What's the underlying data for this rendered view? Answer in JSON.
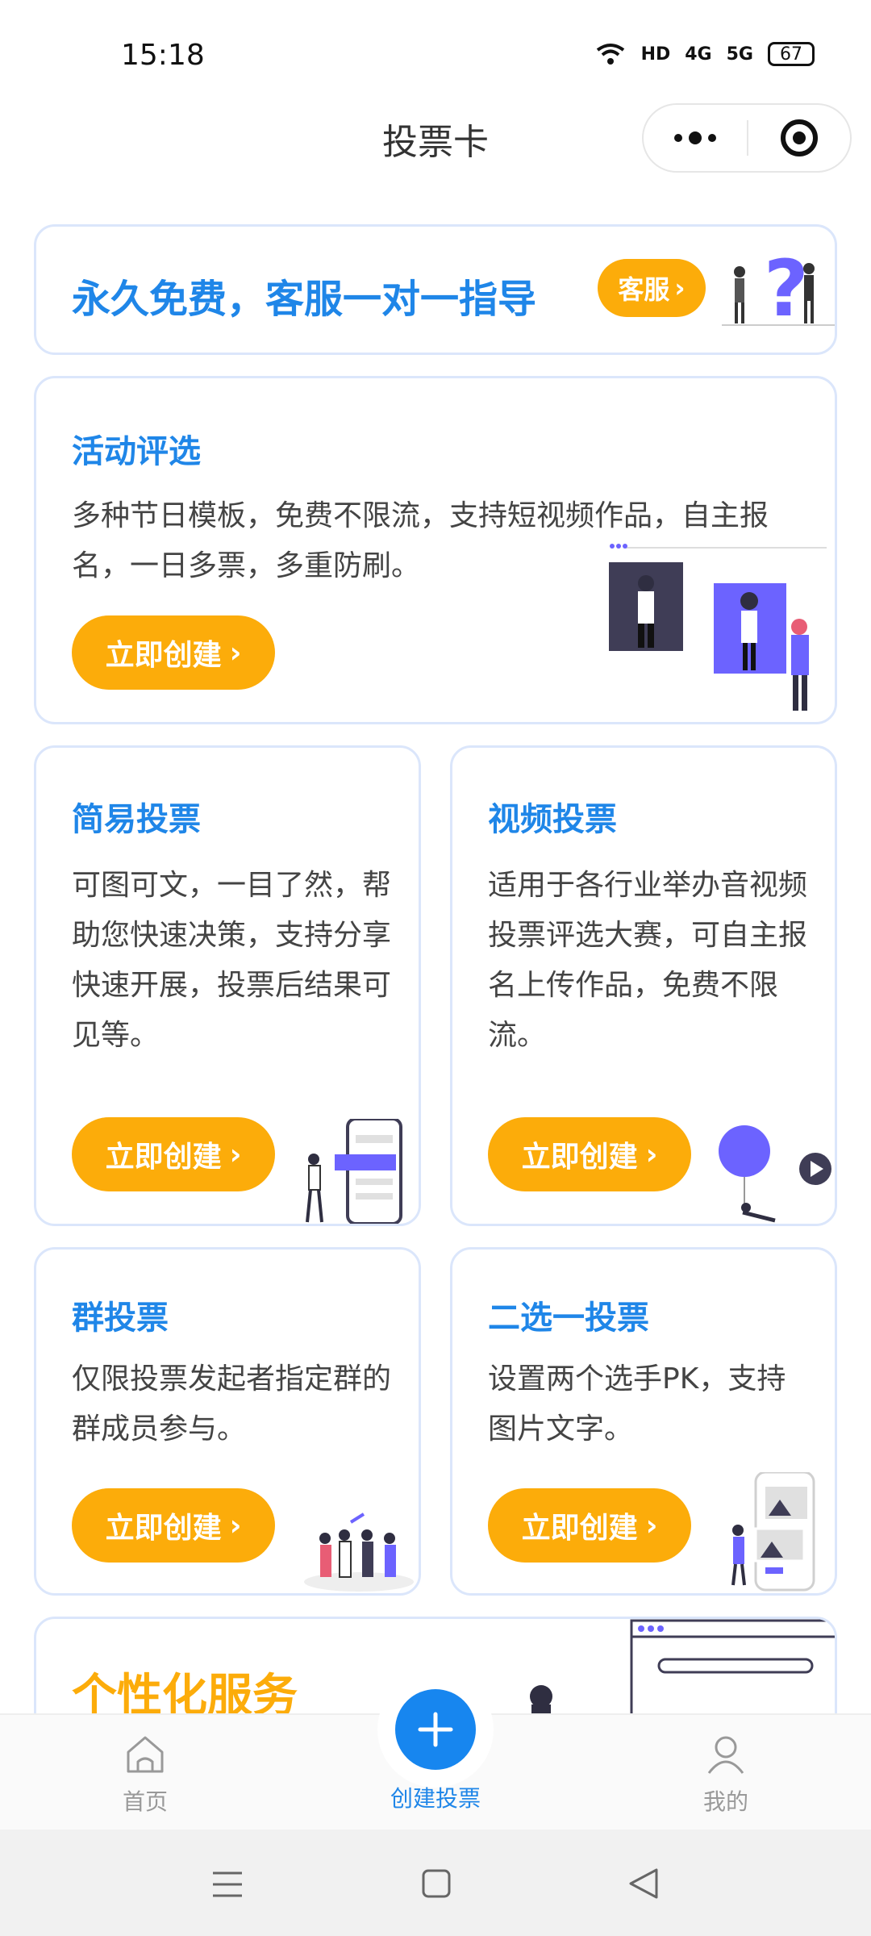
{
  "status_bar": {
    "time": "15:18",
    "network": [
      "HD",
      "4G",
      "5G"
    ],
    "battery": "67"
  },
  "nav": {
    "title": "投票卡"
  },
  "banner": {
    "text": "永久免费，客服一对一指导",
    "button": "客服"
  },
  "cards": {
    "activity": {
      "title": "活动评选",
      "desc": "多种节日模板，免费不限流，支持短视频作品，自主报名，一日多票，多重防刷。",
      "cta": "立即创建"
    },
    "simple": {
      "title": "简易投票",
      "desc": "可图可文，一目了然，帮助您快速决策，支持分享快速开展，投票后结果可见等。",
      "cta": "立即创建"
    },
    "video": {
      "title": "视频投票",
      "desc": "适用于各行业举办音视频投票评选大赛，可自主报名上传作品，免费不限流。",
      "cta": "立即创建"
    },
    "group": {
      "title": "群投票",
      "desc": "仅限投票发起者指定群的群成员参与。",
      "cta": "立即创建"
    },
    "pk": {
      "title": "二选一投票",
      "desc": "设置两个选手PK，支持图片文字。",
      "cta": "立即创建"
    },
    "custom": {
      "title": "个性化服务"
    }
  },
  "tabbar": {
    "home": "首页",
    "create": "创建投票",
    "mine": "我的"
  },
  "colors": {
    "accent_blue": "#1f86e8",
    "accent_orange": "#fcac0a",
    "card_border": "#dbe6fb"
  }
}
